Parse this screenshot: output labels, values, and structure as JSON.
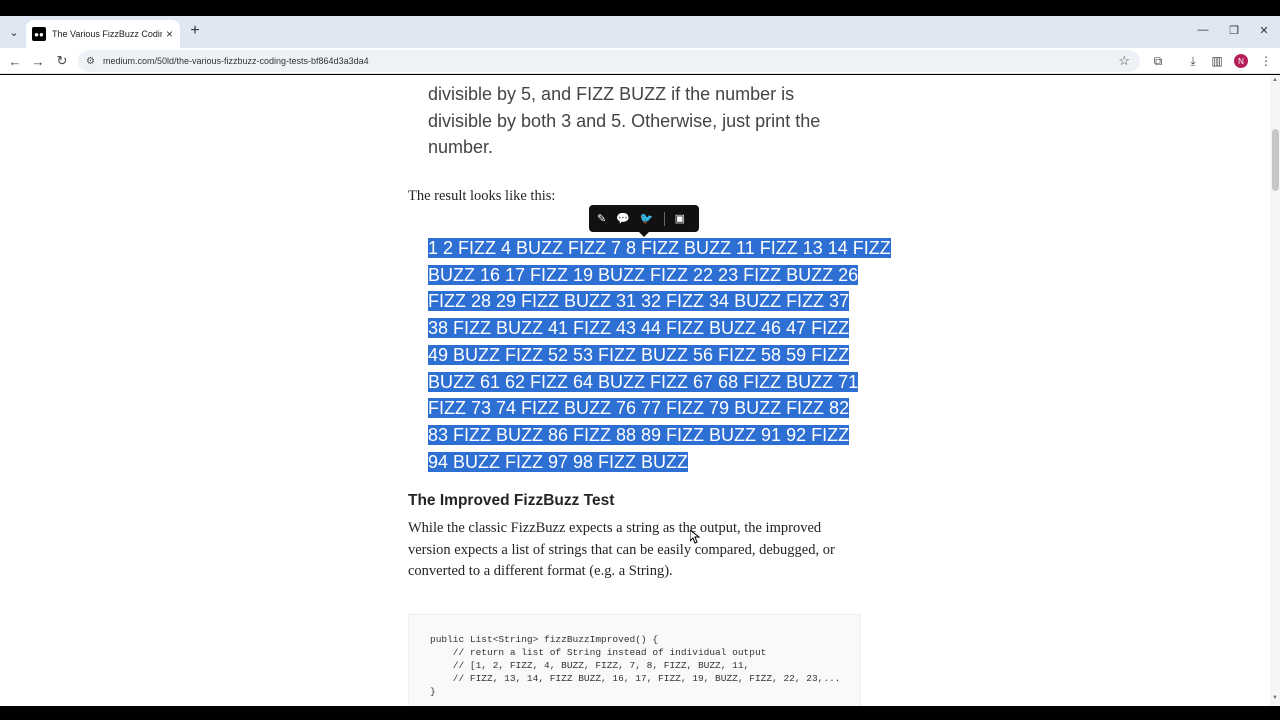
{
  "browser": {
    "tab_title": "The Various FizzBuzz Coding Te",
    "url": "medium.com/50ld/the-various-fizzbuzz-coding-tests-bf864d3a3da4",
    "avatar_letter": "N"
  },
  "article": {
    "quote_lines": [
      "divisible by 5, and FIZZ BUZZ if the number is",
      "divisible by both 3 and 5. Otherwise, just print the",
      "number."
    ],
    "result_intro": "The result looks like this:",
    "fizzbuzz_lines": [
      "1 2 FIZZ 4 BUZZ FIZZ 7 8 FIZZ BUZZ 11 FIZZ 13 14 FIZZ",
      "BUZZ 16 17 FIZZ 19 BUZZ FIZZ 22 23 FIZZ BUZZ 26",
      "FIZZ 28 29 FIZZ BUZZ 31 32 FIZZ 34 BUZZ FIZZ 37",
      "38 FIZZ BUZZ 41 FIZZ 43 44 FIZZ BUZZ 46 47 FIZZ",
      "49 BUZZ FIZZ 52 53 FIZZ BUZZ 56 FIZZ 58 59 FIZZ",
      "BUZZ 61 62 FIZZ 64 BUZZ FIZZ 67 68 FIZZ BUZZ 71",
      "FIZZ 73 74 FIZZ BUZZ 76 77 FIZZ 79 BUZZ FIZZ 82",
      "83 FIZZ BUZZ 86 FIZZ 88 89 FIZZ BUZZ 91 92 FIZZ",
      "94 BUZZ FIZZ 97 98 FIZZ BUZZ"
    ],
    "section_heading": "The Improved FizzBuzz Test",
    "improved_lines": [
      "While the classic FizzBuzz expects a string as the output, the improved",
      "version expects a list of strings that can be easily compared, debugged, or",
      "converted to a different format (e.g. a String)."
    ],
    "code_lines": [
      "public List<String> fizzBuzzImproved() {",
      "    // return a list of String instead of individual output",
      "    // [1, 2, FIZZ, 4, BUZZ, FIZZ, 7, 8, FIZZ, BUZZ, 11,",
      "    // FIZZ, 13, 14, FIZZ BUZZ, 16, 17, FIZZ, 19, BUZZ, FIZZ, 22, 23,...",
      "}"
    ]
  },
  "selection_toolbar": {
    "icons": [
      "highlight-icon",
      "comment-icon",
      "twitter-icon",
      "private-note-icon"
    ]
  },
  "colors": {
    "selection": "#2e6fd3",
    "tab_strip": "#dfe7f3",
    "text": "#242424"
  }
}
